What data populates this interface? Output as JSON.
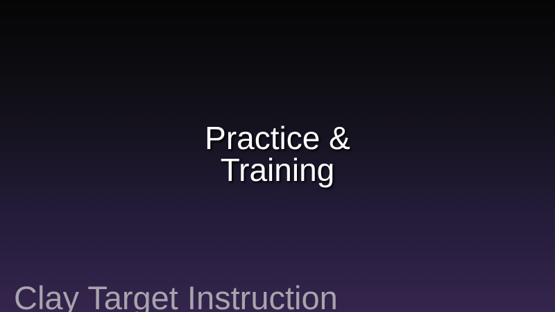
{
  "slide": {
    "title_line_1": "Practice &",
    "title_line_2": "Training",
    "footer_text": "Clay Target Instruction"
  },
  "colors": {
    "background_top": "#050505",
    "background_bottom": "#35254d",
    "title_text": "#ffffff",
    "footer_text": "#a7a4ac"
  }
}
